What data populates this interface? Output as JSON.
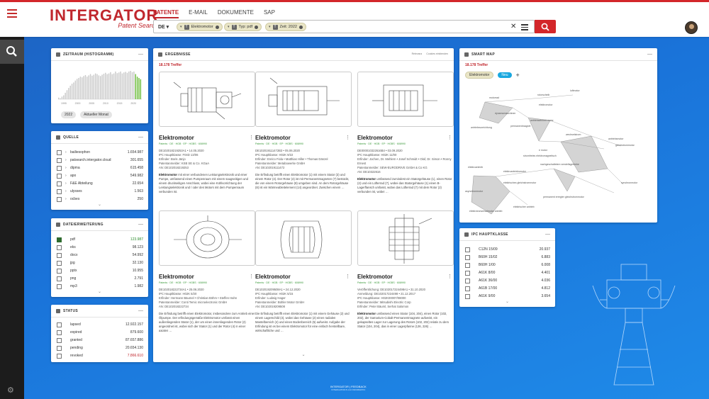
{
  "app": {
    "logo_main": "INTERGATOR",
    "logo_sub": "Patent Search"
  },
  "nav": [
    {
      "label": "PATENTE",
      "active": true
    },
    {
      "label": "E-MAIL",
      "active": false
    },
    {
      "label": "DOKUMENTE",
      "active": false
    },
    {
      "label": "SAP",
      "active": false
    }
  ],
  "search": {
    "language": "DE",
    "chips": [
      {
        "label": "Elektromotor"
      },
      {
        "label": "Typ: pdf"
      },
      {
        "label": "Zeit: 2022"
      }
    ]
  },
  "histogram": {
    "title": "ZEITRAUM (HISTOGRAMM)",
    "ticks": [
      "1995",
      "2000",
      "2005",
      "2010",
      "2015",
      "2020"
    ],
    "bars": [
      5,
      3,
      8,
      12,
      20,
      28,
      35,
      42,
      48,
      52,
      58,
      63,
      66,
      70,
      68,
      72,
      75,
      70,
      74,
      78,
      73,
      76,
      80,
      78,
      74,
      72,
      76,
      79,
      82,
      78,
      80,
      84,
      78,
      80,
      86,
      81,
      83,
      86,
      80,
      83,
      85,
      82,
      86,
      88,
      84,
      86,
      78,
      70,
      66,
      62
    ],
    "green_bars": [
      46,
      47,
      48,
      49
    ],
    "buttons": [
      "2022",
      "Aktueller Monat"
    ]
  },
  "quelle": {
    "title": "QUELLE",
    "rows": [
      {
        "label": "bailiesophon",
        "count": "1.654.987"
      },
      {
        "label": "patsearch.intergator.cloud",
        "count": "301.655"
      },
      {
        "label": "dipma",
        "count": "615.458"
      },
      {
        "label": "apo",
        "count": "549.982"
      },
      {
        "label": "F&E Abteilung",
        "count": "22.654"
      },
      {
        "label": "ulysses",
        "count": "1.563"
      },
      {
        "label": "ocbes",
        "count": "250"
      }
    ]
  },
  "dateierweiterung": {
    "title": "DATEIERWEITERUNG",
    "rows": [
      {
        "label": "pdf",
        "count": "123.987",
        "checked": true
      },
      {
        "label": "eks",
        "count": "98.123",
        "checked": false
      },
      {
        "label": "docx",
        "count": "54.992",
        "checked": false
      },
      {
        "label": "jpg",
        "count": "32.130",
        "checked": false
      },
      {
        "label": "pptx",
        "count": "10.955",
        "checked": false
      },
      {
        "label": "png",
        "count": "2.791",
        "checked": false
      },
      {
        "label": "mp3",
        "count": "1.982",
        "checked": false
      }
    ]
  },
  "status": {
    "title": "STATUS",
    "rows": [
      {
        "label": "lapsed",
        "count": "12.922.157"
      },
      {
        "label": "expired",
        "count": "879.600"
      },
      {
        "label": "granted",
        "count": "87.657.886"
      },
      {
        "label": "pending",
        "count": "20.654.130"
      },
      {
        "label": "revoked",
        "count": "7.866.610"
      }
    ]
  },
  "ergebnisse": {
    "title": "ERGEBNISSE",
    "hits": "18.178 Treffer",
    "controls": [
      "Relevanz",
      "Cookies einblenden"
    ],
    "cards": [
      {
        "title": "Elektromotor",
        "sub": "Patents · DE · HGB · EP · HGBS · 608990",
        "meta": [
          "DE102018219253A1 • 14.05.2020",
          "IPC Hauptklasse: F04D 13/06",
          "Erfinder: Boris Jänjo",
          "Patentanmelder: KSB SE & Co. KGaA",
          "AN: DE102018219253"
        ],
        "body": "mit einer verbundenen Leistungselektronik und einer Pumpe, umfassend einen Pumpenraum mit einem saugseitigen und einem druckseitigen Anschluss, wobei eine Kühlvorrichtung der Leistungselektronik und / oder des Motors mit dem Pumpenraum verbunden ist."
      },
      {
        "title": "Elektromotor",
        "sub": "Patents · DE · HGB · EP · HGBS · 608990",
        "meta": [
          "DE102019111472B3 • 05.06.2020",
          "IPC Hauptklasse: H02K 9/22",
          "Erfinder: Enrico Fiola • Matthias Hiller • Thomas Dänzel",
          "Patentanmelder: Metabowerke GmbH",
          "AN: DE102019111472"
        ],
        "body": "Die Erfindung betrifft einen Elektromotor (1) mit einem Stator (3) und einem Rotor (4). Der Rotor (4) ist mit Permanentmagneten (7) bestückt, die von einem Rotorgehäuse (8) umgeben sind. An dem Rotorgehäuse (8) ist ein Wärmeableitelement (14) angeordnet. Zwischen einem …"
      },
      {
        "title": "Elektromotor",
        "sub": "Patents · DE · HGB · EP · HGBS · 608990",
        "meta": [
          "DE000010322616B4 • 03.09.2020",
          "IPC Hauptklasse: H02K 11/00",
          "Erfinder: Jochen, Dr. Mehlern • Josef Schmidt • Olaf, Dr. Simon • Ronny Ernest",
          "Patentanmelder: SEW-EURODRIVE GmbH & Co KG",
          "AN: DE10322616"
        ],
        "body": "umfassend zumindest ein Statorgehäuse (1), einen Rotor (2) und ein Lüfterrad (7), wobei das Statorgehäuse (1) einen B-Lagerflansch umfasst, wobei das Lüfterrad (7) mit dem Rotor (2) verbunden ist, wobei …"
      },
      {
        "title": "Elektromotor",
        "sub": "Patents · DE · HGB · EP · HGBS · 608990",
        "meta": [
          "DE102018222734A1 • 25.06.2020",
          "IPC Hauptklasse: H02K 5/20",
          "Erfinder: Hermann Bäumel • Christian Böhm • Steffen Hahn",
          "Patentanmelder: Conti Temic microelectronic GmbH",
          "AN: DE102018222734"
        ],
        "body": "Die Erfindung betrifft einen Elektromotor, insbesondere zum Antrieb einer Ölpumpe. Der erfindungsgemäße Elektromotor umfasst einen außenliegenden Stator (1), der um einen innenliegenden Rotor (2) angeordnet ist, wobei sich der Stator (1) und der Rotor (4) in einer axialen …"
      },
      {
        "title": "Elektromotor",
        "sub": "Patents · DE · HGB · EP · HGBS · 608990",
        "meta": [
          "DE102019209508A1 • 24.12.2020",
          "IPC Hauptklasse: H02K 5/15",
          "Erfinder: Ludwig Hager",
          "Patentanmelder: Bühler Motor GmbH",
          "AN: DE102019209508"
        ],
        "body": "Die Erfindung betrifft einen Elektromotor (1) mit einem Gehäuse (2) und einem Lagerschild (3), wobei das Gehäuse (2) einen radialen Mantelbereich (4) und einen Bodenbereich (5) aufweist. Aufgabe der Erfindung ist es bei einem Elektromotor für eine einfach herstellbare, wirtschaftliche und …"
      },
      {
        "title": "Elektromotor",
        "sub": "Patents · DE · HGB · EP · HGBS · 608990",
        "meta": [
          "Veröffentlichung: DE102017224498A1 • 31.10.2020",
          "Anmeldung: DE102017224498 • 21.12.2017",
          "IPC Hauptklasse: H02K00007/08000",
          "Patentanmelder: Mitsubishi Electric Corp",
          "Erfinder: Peter Bäuml, Serhat Salomon"
        ],
        "body": "umfassend einen Stator (104, 204), einen Rotor (102, 202), der Samarium-Cobalt-Permanentmagnete aufweist, ein gekapseltes Lager zur Lagerung des Rotors (102, 202) relativ zu dem Stator (104, 204), das in einer Lagerpfanne (126, 226) …"
      }
    ]
  },
  "smartmap": {
    "title": "SMART MAP",
    "hits": "18.178 Treffer",
    "chips": [
      "Elektromotor",
      "Neu"
    ],
    "nodes": [
      "motorrad",
      "rotorscheib",
      "luftmotor",
      "elektromotor",
      "antriebsvorrichtung",
      "dynamomaschinen",
      "permanentmagnet",
      "antriebseinheit motor",
      "e motor",
      "gleichstrommotor",
      "elektroantrieb",
      "elektroantriebsmotor",
      "wechselstrom",
      "antriebsmotor",
      "stromfreies elektromagnetisch",
      "nachgeschaltetem verstellsgetriebe",
      "synchronmotor",
      "elektrisches gleichstrommotor",
      "asynchronmotor",
      "elektrotranversalmotor antrieb",
      "elektrischer antrieb",
      "permanent erregter gleichstrommotor"
    ]
  },
  "ipc": {
    "title": "IPC HAUPTKLASSE",
    "rows": [
      {
        "label": "C12N 15/09",
        "count": "20.937"
      },
      {
        "label": "B60H 15/02",
        "count": "6.883"
      },
      {
        "label": "B60H 1/00",
        "count": "6.008"
      },
      {
        "label": "A61K 8/00",
        "count": "4.401"
      },
      {
        "label": "A61K 36/00",
        "count": "4.036"
      },
      {
        "label": "A61B 17/00",
        "count": "4.812"
      },
      {
        "label": "A61K 9/00",
        "count": "3.654"
      }
    ]
  },
  "footer": {
    "line1": "INTERGATOR  |  FEEDBACK",
    "line2": "INTERGATOR 8.4.42 INFORMATIC"
  },
  "colors": {
    "accent": "#d3262a",
    "green": "#6dbd3c",
    "background": "#1a73d9"
  }
}
